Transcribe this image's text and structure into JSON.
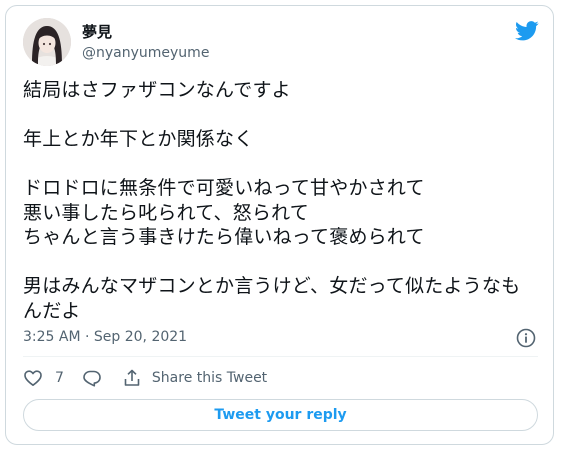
{
  "tweet": {
    "author_name": "夢見",
    "author_handle": "@nyanyumeyume",
    "body": "結局はさファザコンなんですよ\n\n年上とか年下とか関係なく\n\nドロドロに無条件で可愛いねって甘やかされて\n悪い事したら叱られて、怒られて\nちゃんと言う事きけたら偉いねって褒められて\n\n男はみんなマザコンとか言うけど、女だって似たようなもんだよ",
    "timestamp": "3:25 AM · Sep 20, 2021",
    "like_count": "7",
    "share_label": "Share this Tweet",
    "reply_button_label": "Tweet your reply"
  },
  "icons": {
    "brand": "twitter-bird-icon",
    "info": "info-icon",
    "like": "heart-icon",
    "reply": "reply-bubble-icon",
    "share": "share-icon"
  },
  "colors": {
    "brand": "#1d9bf0",
    "text": "#0f1419",
    "secondary": "#536471",
    "border": "#cfd9de"
  }
}
